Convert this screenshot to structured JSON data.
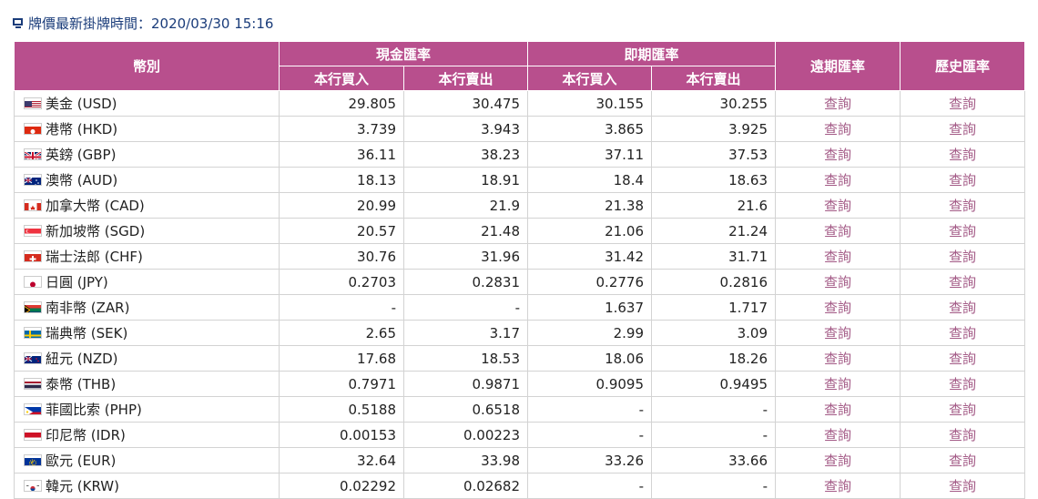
{
  "header": {
    "title": "牌價最新掛牌時間：2020/03/30 15:16"
  },
  "table": {
    "col_currency": "幣別",
    "col_cash": "現金匯率",
    "col_spot": "即期匯率",
    "col_forward": "遠期匯率",
    "col_history": "歷史匯率",
    "sub_buy": "本行買入",
    "sub_sell": "本行賣出",
    "rows": [
      {
        "name": "美金 (USD)",
        "flag": "us-flag-icon",
        "cash_buy": "29.805",
        "cash_sell": "30.475",
        "spot_buy": "30.155",
        "spot_sell": "30.255",
        "forward": "查詢",
        "history": "查詢"
      },
      {
        "name": "港幣 (HKD)",
        "flag": "hk-flag-icon",
        "cash_buy": "3.739",
        "cash_sell": "3.943",
        "spot_buy": "3.865",
        "spot_sell": "3.925",
        "forward": "查詢",
        "history": "查詢"
      },
      {
        "name": "英鎊 (GBP)",
        "flag": "gb-flag-icon",
        "cash_buy": "36.11",
        "cash_sell": "38.23",
        "spot_buy": "37.11",
        "spot_sell": "37.53",
        "forward": "查詢",
        "history": "查詢"
      },
      {
        "name": "澳幣 (AUD)",
        "flag": "au-flag-icon",
        "cash_buy": "18.13",
        "cash_sell": "18.91",
        "spot_buy": "18.4",
        "spot_sell": "18.63",
        "forward": "查詢",
        "history": "查詢"
      },
      {
        "name": "加拿大幣 (CAD)",
        "flag": "ca-flag-icon",
        "cash_buy": "20.99",
        "cash_sell": "21.9",
        "spot_buy": "21.38",
        "spot_sell": "21.6",
        "forward": "查詢",
        "history": "查詢"
      },
      {
        "name": "新加坡幣 (SGD)",
        "flag": "sg-flag-icon",
        "cash_buy": "20.57",
        "cash_sell": "21.48",
        "spot_buy": "21.06",
        "spot_sell": "21.24",
        "forward": "查詢",
        "history": "查詢"
      },
      {
        "name": "瑞士法郎 (CHF)",
        "flag": "ch-flag-icon",
        "cash_buy": "30.76",
        "cash_sell": "31.96",
        "spot_buy": "31.42",
        "spot_sell": "31.71",
        "forward": "查詢",
        "history": "查詢"
      },
      {
        "name": "日圓 (JPY)",
        "flag": "jp-flag-icon",
        "cash_buy": "0.2703",
        "cash_sell": "0.2831",
        "spot_buy": "0.2776",
        "spot_sell": "0.2816",
        "forward": "查詢",
        "history": "查詢"
      },
      {
        "name": "南非幣 (ZAR)",
        "flag": "za-flag-icon",
        "cash_buy": "-",
        "cash_sell": "-",
        "spot_buy": "1.637",
        "spot_sell": "1.717",
        "forward": "查詢",
        "history": "查詢"
      },
      {
        "name": "瑞典幣 (SEK)",
        "flag": "se-flag-icon",
        "cash_buy": "2.65",
        "cash_sell": "3.17",
        "spot_buy": "2.99",
        "spot_sell": "3.09",
        "forward": "查詢",
        "history": "查詢"
      },
      {
        "name": "紐元 (NZD)",
        "flag": "nz-flag-icon",
        "cash_buy": "17.68",
        "cash_sell": "18.53",
        "spot_buy": "18.06",
        "spot_sell": "18.26",
        "forward": "查詢",
        "history": "查詢"
      },
      {
        "name": "泰幣 (THB)",
        "flag": "th-flag-icon",
        "cash_buy": "0.7971",
        "cash_sell": "0.9871",
        "spot_buy": "0.9095",
        "spot_sell": "0.9495",
        "forward": "查詢",
        "history": "查詢"
      },
      {
        "name": "菲國比索 (PHP)",
        "flag": "ph-flag-icon",
        "cash_buy": "0.5188",
        "cash_sell": "0.6518",
        "spot_buy": "-",
        "spot_sell": "-",
        "forward": "查詢",
        "history": "查詢"
      },
      {
        "name": "印尼幣 (IDR)",
        "flag": "id-flag-icon",
        "cash_buy": "0.00153",
        "cash_sell": "0.00223",
        "spot_buy": "-",
        "spot_sell": "-",
        "forward": "查詢",
        "history": "查詢"
      },
      {
        "name": "歐元 (EUR)",
        "flag": "eu-flag-icon",
        "cash_buy": "32.64",
        "cash_sell": "33.98",
        "spot_buy": "33.26",
        "spot_sell": "33.66",
        "forward": "查詢",
        "history": "查詢"
      },
      {
        "name": "韓元 (KRW)",
        "flag": "kr-flag-icon",
        "cash_buy": "0.02292",
        "cash_sell": "0.02682",
        "spot_buy": "-",
        "spot_sell": "-",
        "forward": "查詢",
        "history": "查詢"
      }
    ]
  },
  "colors": {
    "header_bg": "#b84f8d",
    "link": "#a35a86",
    "title": "#1a3c7a"
  }
}
